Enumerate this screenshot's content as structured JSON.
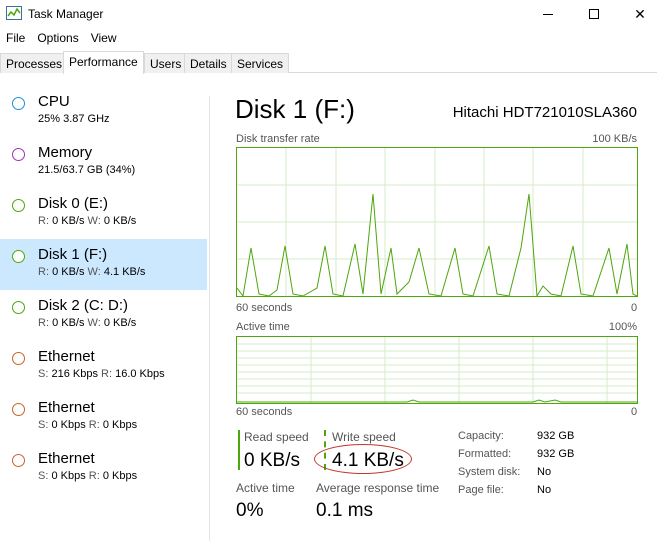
{
  "window": {
    "title": "Task Manager"
  },
  "menu": [
    "File",
    "Options",
    "View"
  ],
  "tabs": [
    {
      "label": "Processes",
      "active": false
    },
    {
      "label": "Performance",
      "active": true
    },
    {
      "label": "Users",
      "active": false
    },
    {
      "label": "Details",
      "active": false
    },
    {
      "label": "Services",
      "active": false
    }
  ],
  "sidebar": {
    "items": [
      {
        "title": "CPU",
        "sub": "25%  3.87 GHz",
        "color": "#1e90d8",
        "selected": false
      },
      {
        "title": "Memory",
        "sub": "21.5/63.7 GB (34%)",
        "color": "#9b33b5",
        "selected": false
      },
      {
        "title": "Disk 0 (E:)",
        "sub_r_label": "R:",
        "sub_r": "0 KB/s",
        "sub_w_label": "W:",
        "sub_w": "0 KB/s",
        "color": "#4da60c",
        "selected": false
      },
      {
        "title": "Disk 1 (F:)",
        "sub_r_label": "R:",
        "sub_r": "0 KB/s",
        "sub_w_label": "W:",
        "sub_w": "4.1 KB/s",
        "color": "#4da60c",
        "selected": true
      },
      {
        "title": "Disk 2 (C: D:)",
        "sub_r_label": "R:",
        "sub_r": "0 KB/s",
        "sub_w_label": "W:",
        "sub_w": "0 KB/s",
        "color": "#4da60c",
        "selected": false
      },
      {
        "title": "Ethernet",
        "sub_r_label": "S:",
        "sub_r": "216 Kbps",
        "sub_w_label": "R:",
        "sub_w": "16.0 Kbps",
        "color": "#c8642a",
        "selected": false
      },
      {
        "title": "Ethernet",
        "sub_r_label": "S:",
        "sub_r": "0 Kbps",
        "sub_w_label": "R:",
        "sub_w": "0 Kbps",
        "color": "#c8642a",
        "selected": false
      },
      {
        "title": "Ethernet",
        "sub_r_label": "S:",
        "sub_r": "0 Kbps",
        "sub_w_label": "R:",
        "sub_w": "0 Kbps",
        "color": "#c8642a",
        "selected": false
      }
    ]
  },
  "main": {
    "title": "Disk 1 (F:)",
    "model": "Hitachi HDT721010SLA360",
    "graph1": {
      "label": "Disk transfer rate",
      "max": "100 KB/s",
      "time": "60 seconds",
      "min": "0"
    },
    "graph2": {
      "label": "Active time",
      "max": "100%",
      "time": "60 seconds",
      "min": "0"
    },
    "stats": {
      "read_label": "Read speed",
      "read_value": "0 KB/s",
      "write_label": "Write speed",
      "write_value": "4.1 KB/s",
      "active_label": "Active time",
      "active_value": "0%",
      "resp_label": "Average response time",
      "resp_value": "0.1 ms"
    },
    "details": [
      {
        "label": "Capacity:",
        "value": "932 GB"
      },
      {
        "label": "Formatted:",
        "value": "932 GB"
      },
      {
        "label": "System disk:",
        "value": "No"
      },
      {
        "label": "Page file:",
        "value": "No"
      }
    ]
  },
  "colors": {
    "disk_green": "#4da60c",
    "selected_bg": "#cce8ff",
    "annotation_red": "#c0392b"
  }
}
